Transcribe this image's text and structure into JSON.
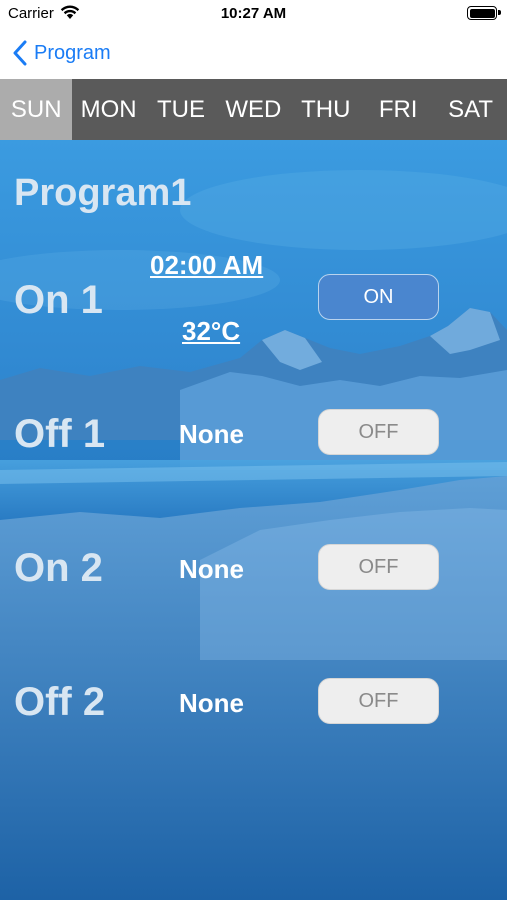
{
  "status_bar": {
    "carrier": "Carrier",
    "time": "10:27 AM"
  },
  "nav": {
    "back_label": "Program"
  },
  "days": [
    "SUN",
    "MON",
    "TUE",
    "WED",
    "THU",
    "FRI",
    "SAT"
  ],
  "selected_day": "SUN",
  "program": {
    "title": "Program1",
    "on1": {
      "label": "On 1",
      "time": "02:00 AM",
      "temp": "32°C",
      "toggle": "ON"
    },
    "off1": {
      "label": "Off 1",
      "value": "None",
      "toggle": "OFF"
    },
    "on2": {
      "label": "On 2",
      "value": "None",
      "toggle": "OFF"
    },
    "off2": {
      "label": "Off 2",
      "value": "None",
      "toggle": "OFF"
    }
  },
  "colors": {
    "accent": "#1a7cf5",
    "tab_bar": "#5a5a5a",
    "tab_active": "#acacac",
    "toggle_on": "#4a86cf",
    "toggle_off": "#eeeeee"
  }
}
